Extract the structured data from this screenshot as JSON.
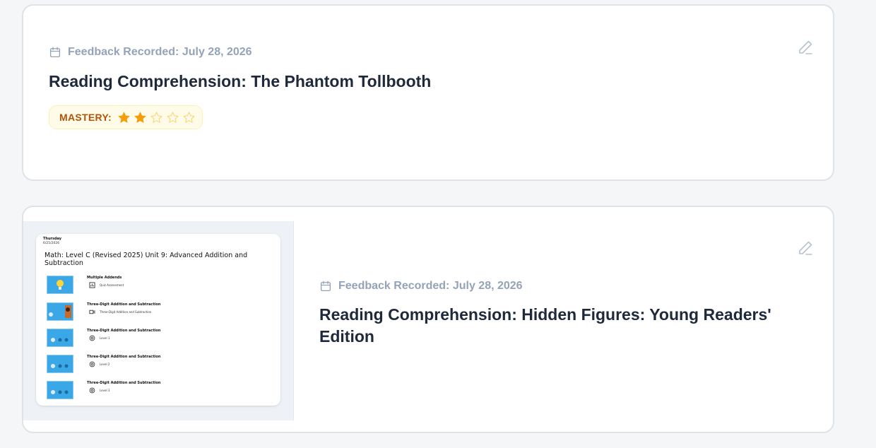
{
  "colors": {
    "accent_star": "#f59e0b",
    "mastery_text": "#b45309",
    "meta_text": "#94a3b8",
    "title_text": "#1e293b"
  },
  "cards": [
    {
      "feedback_date": "Feedback Recorded: July 28, 2026",
      "title": "Reading Comprehension: The Phantom Tollbooth",
      "mastery_label": "MASTERY:",
      "mastery_rating": 2,
      "mastery_max": 5,
      "edit_icon": "pencil-icon"
    },
    {
      "feedback_date": "Feedback Recorded: July 28, 2026",
      "title": "Reading Comprehension: Hidden Figures: Young Readers' Edition",
      "edit_icon": "pencil-icon",
      "thumbnail": {
        "day": "Thursday",
        "date": "6/25/2026",
        "title": "Math: Level C (Revised 2025) Unit 9: Advanced Addition and Subtraction",
        "rows": [
          {
            "title": "Multiple Addends",
            "sub_icon": "chart-icon",
            "sub": "Quiz Assessment",
            "thumb": "lightbulb"
          },
          {
            "title": "Three-Digit Addition and Subtraction",
            "sub_icon": "video-icon",
            "sub": "Three-Digit Addition and Subtraction",
            "thumb": "video"
          },
          {
            "title": "Three-Digit Addition and Subtraction",
            "sub_icon": "target-icon",
            "sub": "Level 1",
            "thumb": "game"
          },
          {
            "title": "Three-Digit Addition and Subtraction",
            "sub_icon": "target-icon",
            "sub": "Level 2",
            "thumb": "game"
          },
          {
            "title": "Three-Digit Addition and Subtraction",
            "sub_icon": "target-icon",
            "sub": "Level 3",
            "thumb": "game"
          }
        ]
      }
    }
  ]
}
